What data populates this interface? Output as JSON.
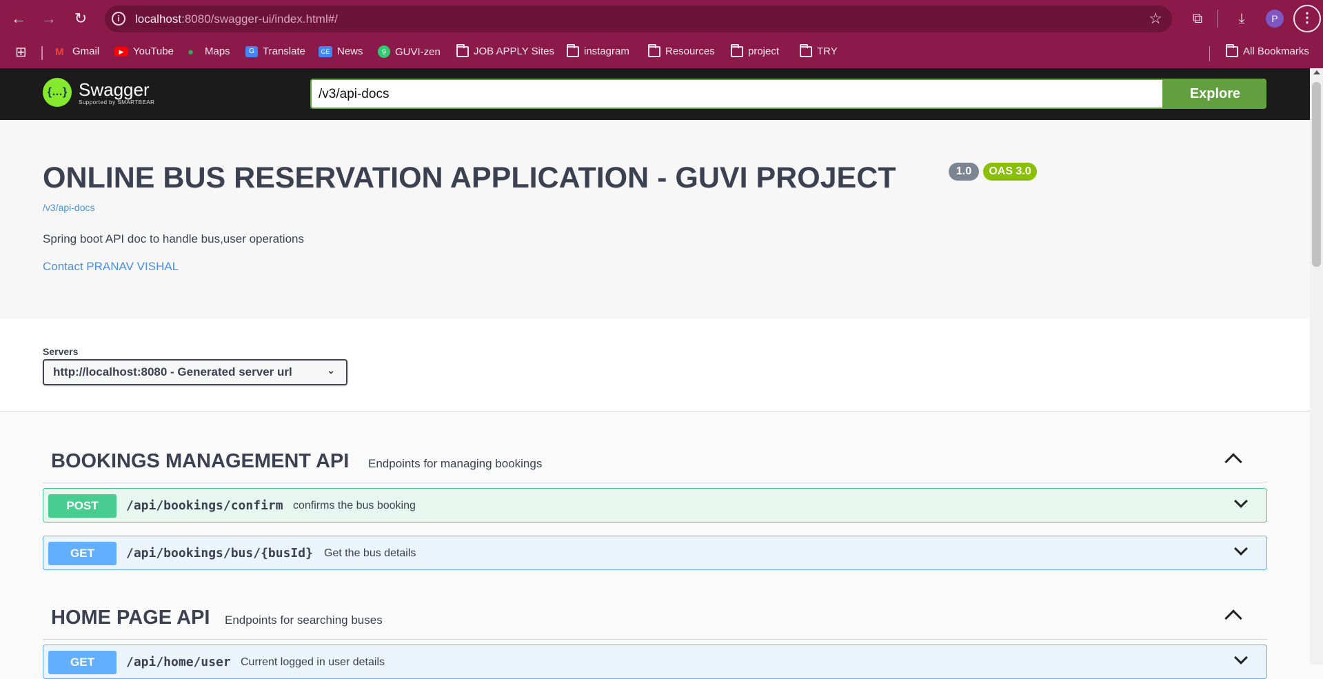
{
  "browser": {
    "url_host": "localhost",
    "url_rest": ":8080/swagger-ui/index.html#/",
    "avatar_letter": "P",
    "bookmarks": [
      {
        "label": "Gmail",
        "icon": "gmail-icon"
      },
      {
        "label": "YouTube",
        "icon": "youtube-icon"
      },
      {
        "label": "Maps",
        "icon": "maps-icon"
      },
      {
        "label": "Translate",
        "icon": "translate-icon"
      },
      {
        "label": "News",
        "icon": "news-icon"
      },
      {
        "label": "GUVI-zen",
        "icon": "guvi-icon"
      },
      {
        "label": "JOB APPLY Sites",
        "icon": "folder-icon"
      },
      {
        "label": "instagram",
        "icon": "folder-icon"
      },
      {
        "label": "Resources",
        "icon": "folder-icon"
      },
      {
        "label": "project",
        "icon": "folder-icon"
      },
      {
        "label": "TRY",
        "icon": "folder-icon"
      }
    ],
    "all_bookmarks": "All Bookmarks"
  },
  "topbar": {
    "logo_text": "Swagger",
    "logo_sub": "Supported by SMARTBEAR",
    "spec_url": "/v3/api-docs",
    "explore_label": "Explore"
  },
  "info": {
    "title": "ONLINE BUS RESERVATION APPLICATION - GUVI PROJECT",
    "version": "1.0",
    "oas": "OAS 3.0",
    "spec_link": "/v3/api-docs",
    "description": "Spring boot API doc to handle bus,user operations",
    "contact": "Contact PRANAV VISHAL"
  },
  "servers": {
    "label": "Servers",
    "selected": "http://localhost:8080 - Generated server url"
  },
  "tags": [
    {
      "name": "BOOKINGS MANAGEMENT API",
      "description": "Endpoints for managing bookings",
      "operations": [
        {
          "method": "POST",
          "path": "/api/bookings/confirm",
          "summary": "confirms the bus booking"
        },
        {
          "method": "GET",
          "path": "/api/bookings/bus/{busId}",
          "summary": "Get the bus details"
        }
      ]
    },
    {
      "name": "HOME PAGE API",
      "description": "Endpoints for searching buses",
      "operations": [
        {
          "method": "GET",
          "path": "/api/home/user",
          "summary": "Current logged in user details"
        }
      ]
    }
  ],
  "colors": {
    "browser_bg": "#8b1a4a",
    "post": "#49cc90",
    "get": "#61affe",
    "explore": "#62a03f"
  }
}
